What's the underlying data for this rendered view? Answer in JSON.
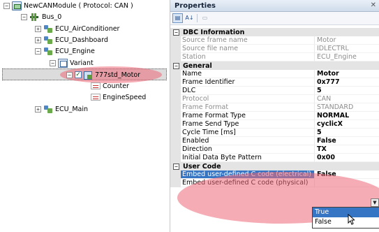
{
  "tree": {
    "root_label": "NewCANModule ( Protocol: CAN )",
    "bus_label": "Bus_0",
    "ecus": [
      {
        "label": "ECU_AirConditioner"
      },
      {
        "label": "ECU_Dashboard"
      },
      {
        "label": "ECU_Engine"
      },
      {
        "label": "ECU_Main"
      }
    ],
    "variant_label": "Variant",
    "message_label": "777std_Motor",
    "signals": [
      {
        "label": "Counter"
      },
      {
        "label": "EngineSpeed"
      }
    ],
    "expander_plus": "+",
    "expander_minus": "−",
    "check": "✓"
  },
  "properties": {
    "title": "Properties",
    "close_glyph": "✕",
    "toolbar": {
      "categorized": "▤",
      "alphabetical": "A↓",
      "pages": "▭"
    },
    "categories": [
      {
        "name": "DBC Information",
        "rows": [
          {
            "name": "Source frame name",
            "value": "Motor",
            "readonly": true
          },
          {
            "name": "Source file name",
            "value": "IDLECTRL",
            "readonly": true
          },
          {
            "name": "Station",
            "value": "ECU_Engine",
            "readonly": true
          }
        ]
      },
      {
        "name": "General",
        "rows": [
          {
            "name": "Name",
            "value": "Motor",
            "bold": true
          },
          {
            "name": "Frame Identifier",
            "value": "0x777",
            "bold": true
          },
          {
            "name": "DLC",
            "value": "5",
            "bold": true
          },
          {
            "name": "Protocol",
            "value": "CAN",
            "readonly": true
          },
          {
            "name": "Frame Format",
            "value": "STANDARD",
            "readonly": true
          },
          {
            "name": "Frame Format Type",
            "value": "NORMAL",
            "bold": true
          },
          {
            "name": "Frame Send Type",
            "value": "cyclicX",
            "bold": true
          },
          {
            "name": "Cycle Time [ms]",
            "value": "5",
            "bold": true
          },
          {
            "name": "Enabled",
            "value": "False",
            "bold": true
          },
          {
            "name": "Direction",
            "value": "TX",
            "bold": true
          },
          {
            "name": "Initial Data Byte Pattern",
            "value": "0x00",
            "bold": true
          }
        ]
      },
      {
        "name": "User Code",
        "rows": [
          {
            "name": "Embed user-defined C code (electrical)",
            "value": "False",
            "selected": true
          },
          {
            "name": "Embed user-defined C code (physical)",
            "value": ""
          }
        ]
      }
    ],
    "collapse_glyph": "−",
    "combo_arrow": "▼",
    "dropdown_options": [
      "True",
      "False"
    ],
    "highlighted_option": "True"
  },
  "colors": {
    "selection_blue": "#3675c4",
    "highlight_ellipse": "#ec6876"
  }
}
